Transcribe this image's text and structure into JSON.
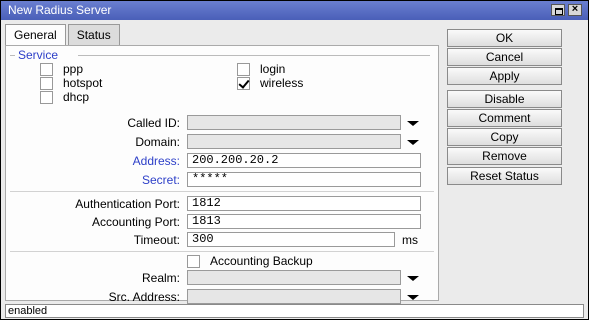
{
  "window": {
    "title": "New Radius Server"
  },
  "tabs": [
    {
      "label": "General",
      "active": true
    },
    {
      "label": "Status",
      "active": false
    }
  ],
  "service": {
    "group_label": "Service",
    "options": [
      {
        "label": "ppp",
        "checked": false
      },
      {
        "label": "login",
        "checked": false
      },
      {
        "label": "hotspot",
        "checked": false
      },
      {
        "label": "wireless",
        "checked": true
      },
      {
        "label": "dhcp",
        "checked": false
      }
    ]
  },
  "fields": {
    "called_id": {
      "label": "Called ID:",
      "value": ""
    },
    "domain": {
      "label": "Domain:",
      "value": ""
    },
    "address": {
      "label": "Address:",
      "value": "200.200.20.2"
    },
    "secret": {
      "label": "Secret:",
      "value": "*****"
    },
    "auth_port": {
      "label": "Authentication Port:",
      "value": "1812"
    },
    "acct_port": {
      "label": "Accounting Port:",
      "value": "1813"
    },
    "timeout": {
      "label": "Timeout:",
      "value": "300",
      "unit": "ms"
    },
    "accounting_backup": {
      "label": "Accounting Backup",
      "checked": false
    },
    "realm": {
      "label": "Realm:",
      "value": ""
    },
    "src_address": {
      "label": "Src. Address:",
      "value": ""
    }
  },
  "buttons": {
    "ok": "OK",
    "cancel": "Cancel",
    "apply": "Apply",
    "disable": "Disable",
    "comment": "Comment",
    "copy": "Copy",
    "remove": "Remove",
    "reset_status": "Reset Status"
  },
  "status_bar": {
    "text": "enabled"
  },
  "colors": {
    "title_bar": "#4a5fb8",
    "accent_label": "#2d3fc8"
  }
}
